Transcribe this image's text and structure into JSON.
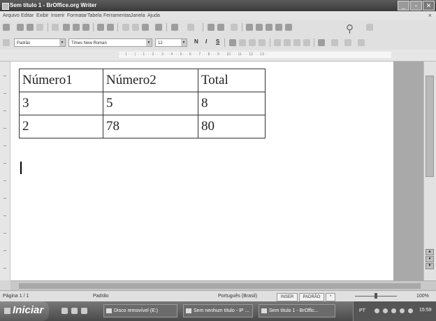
{
  "window": {
    "title": "Sem título 1 - BrOffice.org Writer",
    "controls": {
      "minimize": "_",
      "maximize": "▫",
      "close": "✕"
    }
  },
  "menu": {
    "items": [
      "Arquivo",
      "Editar",
      "Exibir",
      "Inserir",
      "Formatar",
      "Tabela",
      "Ferramentas",
      "Janela",
      "Ajuda"
    ],
    "close_document": "×"
  },
  "format_toolbar": {
    "style": "Padrão",
    "font": "Times New Roman",
    "size": "12",
    "bold": "N",
    "italic": "I",
    "underline": "S"
  },
  "ruler": {
    "scale": "· · · 1 · · · | · · · 1 · · · 2 · · · 3 · · · 4 · · · 5 · · · 6 · · · 7 · · · 8 · · · 9 · · · 10 · · · 11 · · · 12 · · · 13 · ·"
  },
  "table": {
    "rows": [
      [
        "Número1",
        "Número2",
        "Total"
      ],
      [
        "3",
        "5",
        "8"
      ],
      [
        "2",
        "78",
        "80"
      ]
    ]
  },
  "statusbar": {
    "page": "Página 1 / 1",
    "style": "Padrão",
    "language": "Português (Brasil)",
    "insert_mode": "INSER",
    "selection_mode": "PADRÃO",
    "modified_marker": "*",
    "zoom": "100%"
  },
  "taskbar": {
    "start_label": "Iniciar",
    "tasks": [
      "Disco removível (E:)",
      "Sem nenhum título - IP ...",
      "Sem título 1 - BrOffic..."
    ],
    "tray_language": "PT",
    "clock": "15:59"
  }
}
